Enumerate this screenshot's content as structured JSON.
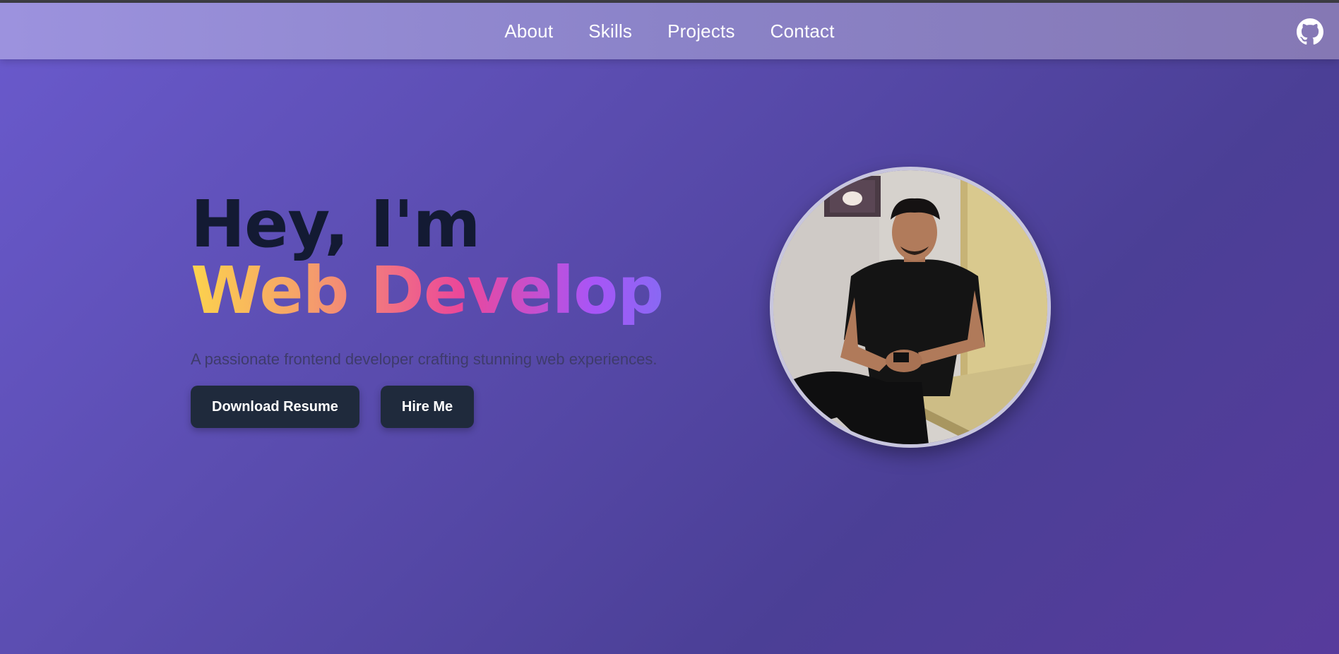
{
  "nav": {
    "links": [
      {
        "label": "About"
      },
      {
        "label": "Skills"
      },
      {
        "label": "Projects"
      },
      {
        "label": "Contact"
      }
    ],
    "github_icon": "github-icon"
  },
  "hero": {
    "greeting": "Hey, I'm",
    "role": "Web Develop",
    "tagline": "A passionate frontend developer crafting stunning web experiences.",
    "buttons": {
      "download_resume": "Download Resume",
      "hire_me": "Hire Me"
    },
    "profile_photo": "profile-photo"
  },
  "colors": {
    "nav_bg": "#9c92de",
    "page_bg": "#5b4db0",
    "button_bg": "#1f2a3c",
    "heading_dark": "#131a33",
    "gradient": [
      "#fcd34d",
      "#f59e6b",
      "#ec4899",
      "#a855f7",
      "#6b7bf0"
    ]
  }
}
